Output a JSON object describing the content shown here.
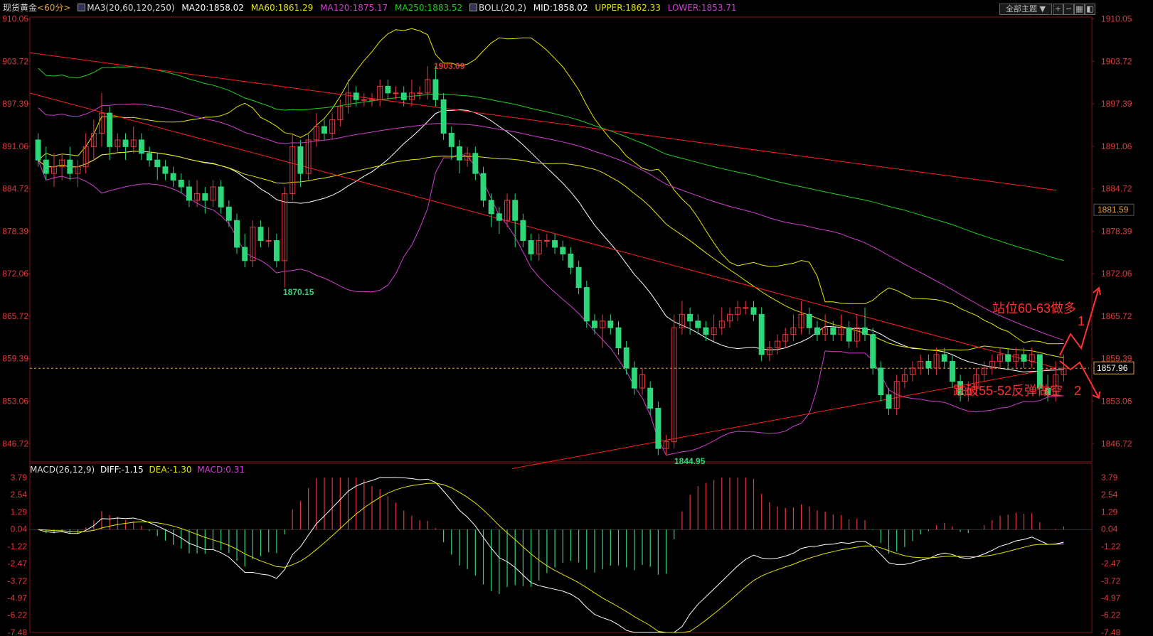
{
  "header": {
    "symbol": "现货黄金",
    "period": "<60分>",
    "ma_label": "MA3(20,60,120,250)",
    "ma20": "MA20:1858.02",
    "ma60": "MA60:1861.29",
    "ma120": "MA120:1875.17",
    "ma250": "MA250:1883.52",
    "boll_label": "BOLL(20,2)",
    "boll_mid": "MID:1858.02",
    "boll_upper": "UPPER:1862.33",
    "boll_lower": "LOWER:1853.71",
    "theme_button": "全部主题"
  },
  "colors": {
    "up": "#e8383d",
    "down": "#2ed67a",
    "ma20": "#ffffff",
    "ma60": "#e6e600",
    "ma120": "#d23cd2",
    "ma250": "#1fd01f",
    "trend": "#ff2020",
    "diff": "#ffffff",
    "dea": "#e6e600",
    "macd": "#d23cd2"
  },
  "chart_data": [
    {
      "type": "candlestick",
      "title": "现货黄金 60分",
      "ylim": [
        1844,
        1910
      ],
      "y_ticks": [
        "910.05",
        "903.72",
        "897.39",
        "891.06",
        "884.72",
        "878.39",
        "872.06",
        "865.72",
        "859.39",
        "853.06",
        "846.72"
      ],
      "right_ticks": [
        "1910.05",
        "1903.72",
        "1897.39",
        "1891.06",
        "1884.72",
        "1878.39",
        "1872.06",
        "1865.72",
        "1859.39",
        "1853.06",
        "1846.72"
      ],
      "current_price": "1857.96",
      "marked_level": "1881.59",
      "high_label": "1903.09",
      "low_labels": [
        "1870.15",
        "1844.95"
      ],
      "annotations": [
        "站位60-63做多",
        "1",
        "跌破55-52反弹做空",
        "2"
      ],
      "candles": [
        [
          1892,
          1889,
          1893,
          1888
        ],
        [
          1889,
          1887,
          1891,
          1886
        ],
        [
          1887,
          1888,
          1890,
          1885
        ],
        [
          1888,
          1889,
          1890,
          1886
        ],
        [
          1889,
          1887,
          1891,
          1886
        ],
        [
          1887,
          1888,
          1889,
          1885
        ],
        [
          1888,
          1891,
          1893,
          1887
        ],
        [
          1891,
          1893,
          1895,
          1889
        ],
        [
          1893,
          1896,
          1899,
          1891
        ],
        [
          1896,
          1891,
          1897,
          1889
        ],
        [
          1891,
          1892,
          1893,
          1890
        ],
        [
          1892,
          1891,
          1893,
          1889
        ],
        [
          1891,
          1892,
          1894,
          1890
        ],
        [
          1892,
          1890,
          1893,
          1889
        ],
        [
          1890,
          1889,
          1891,
          1888
        ],
        [
          1889,
          1888,
          1890,
          1886
        ],
        [
          1888,
          1887,
          1889,
          1886
        ],
        [
          1887,
          1886,
          1888,
          1885
        ],
        [
          1886,
          1885,
          1887,
          1884
        ],
        [
          1885,
          1883,
          1886,
          1882
        ],
        [
          1883,
          1884,
          1886,
          1882
        ],
        [
          1884,
          1883,
          1885,
          1881
        ],
        [
          1883,
          1885,
          1886,
          1882
        ],
        [
          1885,
          1882,
          1886,
          1881
        ],
        [
          1882,
          1880,
          1883,
          1879
        ],
        [
          1880,
          1876,
          1881,
          1875
        ],
        [
          1876,
          1874,
          1878,
          1873
        ],
        [
          1874,
          1879,
          1880,
          1873
        ],
        [
          1879,
          1877,
          1880,
          1876
        ],
        [
          1877,
          1877,
          1879,
          1876
        ],
        [
          1877,
          1874,
          1878,
          1873
        ],
        [
          1874,
          1884,
          1885,
          1870
        ],
        [
          1884,
          1891,
          1893,
          1883
        ],
        [
          1891,
          1887,
          1892,
          1885
        ],
        [
          1887,
          1892,
          1893,
          1886
        ],
        [
          1892,
          1894,
          1896,
          1891
        ],
        [
          1894,
          1893,
          1895,
          1892
        ],
        [
          1893,
          1895,
          1896,
          1892
        ],
        [
          1895,
          1897,
          1898,
          1894
        ],
        [
          1897,
          1899,
          1901,
          1896
        ],
        [
          1899,
          1898,
          1900,
          1897
        ],
        [
          1898,
          1898,
          1899,
          1897
        ],
        [
          1898,
          1898,
          1899,
          1897
        ],
        [
          1898,
          1900,
          1901,
          1897
        ],
        [
          1900,
          1899,
          1901,
          1898
        ],
        [
          1899,
          1899,
          1900,
          1898
        ],
        [
          1899,
          1898,
          1900,
          1897
        ],
        [
          1898,
          1899,
          1901,
          1897
        ],
        [
          1899,
          1899,
          1900,
          1898
        ],
        [
          1899,
          1901,
          1903,
          1898
        ],
        [
          1901,
          1898,
          1903,
          1897
        ],
        [
          1898,
          1893,
          1899,
          1892
        ],
        [
          1893,
          1891,
          1894,
          1889
        ],
        [
          1891,
          1889,
          1892,
          1887
        ],
        [
          1889,
          1890,
          1891,
          1888
        ],
        [
          1890,
          1887,
          1891,
          1886
        ],
        [
          1887,
          1883,
          1888,
          1882
        ],
        [
          1883,
          1881,
          1884,
          1879
        ],
        [
          1881,
          1880,
          1882,
          1878
        ],
        [
          1880,
          1883,
          1884,
          1879
        ],
        [
          1883,
          1880,
          1884,
          1876
        ],
        [
          1880,
          1877,
          1881,
          1876
        ],
        [
          1877,
          1875,
          1878,
          1874
        ],
        [
          1875,
          1877,
          1878,
          1874
        ],
        [
          1877,
          1877,
          1878,
          1876
        ],
        [
          1877,
          1876,
          1878,
          1875
        ],
        [
          1876,
          1875,
          1877,
          1874
        ],
        [
          1875,
          1873,
          1876,
          1872
        ],
        [
          1873,
          1870,
          1874,
          1869
        ],
        [
          1870,
          1865,
          1871,
          1864
        ],
        [
          1865,
          1864,
          1866,
          1863
        ],
        [
          1864,
          1865,
          1866,
          1861
        ],
        [
          1865,
          1864,
          1866,
          1863
        ],
        [
          1864,
          1861,
          1865,
          1860
        ],
        [
          1861,
          1858,
          1862,
          1857
        ],
        [
          1858,
          1855,
          1859,
          1854
        ],
        [
          1855,
          1857,
          1858,
          1854
        ],
        [
          1855,
          1852,
          1856,
          1851
        ],
        [
          1852,
          1846,
          1853,
          1845
        ],
        [
          1846,
          1847,
          1848,
          1845
        ],
        [
          1847,
          1864,
          1866,
          1846
        ],
        [
          1864,
          1866,
          1868,
          1863
        ],
        [
          1866,
          1865,
          1867,
          1863
        ],
        [
          1865,
          1864,
          1866,
          1863
        ],
        [
          1864,
          1863,
          1865,
          1862
        ],
        [
          1863,
          1864,
          1866,
          1862
        ],
        [
          1864,
          1865,
          1867,
          1863
        ],
        [
          1865,
          1866,
          1867,
          1864
        ],
        [
          1866,
          1867,
          1868,
          1865
        ],
        [
          1867,
          1867,
          1868,
          1866
        ],
        [
          1867,
          1866,
          1868,
          1865
        ],
        [
          1866,
          1860,
          1867,
          1859
        ],
        [
          1860,
          1861,
          1862,
          1859
        ],
        [
          1861,
          1862,
          1863,
          1860
        ],
        [
          1862,
          1863,
          1864,
          1861
        ],
        [
          1863,
          1864,
          1866,
          1862
        ],
        [
          1864,
          1866,
          1868,
          1863
        ],
        [
          1866,
          1864,
          1867,
          1863
        ],
        [
          1864,
          1863,
          1865,
          1862
        ],
        [
          1863,
          1864,
          1866,
          1862
        ],
        [
          1864,
          1863,
          1865,
          1862
        ],
        [
          1863,
          1864,
          1866,
          1862
        ],
        [
          1864,
          1862,
          1865,
          1861
        ],
        [
          1862,
          1864,
          1866,
          1861
        ],
        [
          1864,
          1863,
          1867,
          1862
        ],
        [
          1863,
          1858,
          1864,
          1857
        ],
        [
          1858,
          1854,
          1859,
          1853
        ],
        [
          1854,
          1852,
          1855,
          1851
        ],
        [
          1852,
          1856,
          1857,
          1851
        ],
        [
          1856,
          1857,
          1858,
          1855
        ],
        [
          1857,
          1858,
          1859,
          1856
        ],
        [
          1858,
          1859,
          1860,
          1857
        ],
        [
          1859,
          1858,
          1860,
          1857
        ],
        [
          1858,
          1860,
          1861,
          1857
        ],
        [
          1860,
          1859,
          1861,
          1858
        ],
        [
          1859,
          1856,
          1860,
          1855
        ],
        [
          1856,
          1854,
          1857,
          1853
        ],
        [
          1854,
          1855,
          1856,
          1853
        ],
        [
          1855,
          1857,
          1858,
          1854
        ],
        [
          1857,
          1858,
          1859,
          1856
        ],
        [
          1858,
          1859,
          1860,
          1857
        ],
        [
          1859,
          1860,
          1861,
          1858
        ],
        [
          1860,
          1859,
          1861,
          1858
        ],
        [
          1859,
          1860,
          1861,
          1858
        ],
        [
          1860,
          1859,
          1861,
          1858
        ],
        [
          1859,
          1860,
          1861,
          1858
        ],
        [
          1860,
          1855,
          1860,
          1854
        ],
        [
          1855,
          1854,
          1857,
          1853
        ],
        [
          1854,
          1857,
          1859,
          1853
        ],
        [
          1857,
          1858,
          1860,
          1856
        ]
      ]
    },
    {
      "type": "bar",
      "title": "MACD(26,12,9)",
      "diff_label": "DIFF:-1.15",
      "dea_label": "DEA:-1.30",
      "macd_label": "MACD:0.31",
      "ylim": [
        -7.48,
        3.79
      ],
      "y_ticks": [
        "3.79",
        "2.54",
        "1.29",
        "0.04",
        "-1.22",
        "-2.47",
        "-3.72",
        "-4.97",
        "-6.22",
        "-7.48"
      ]
    }
  ]
}
